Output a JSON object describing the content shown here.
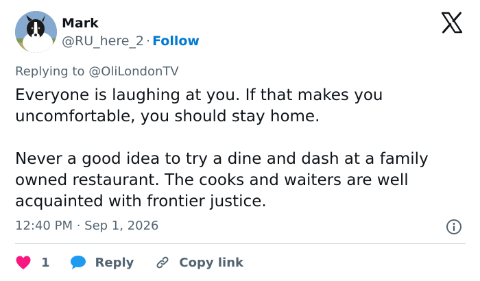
{
  "author": {
    "name": "Mark",
    "handle": "@RU_here_2",
    "separator": "·",
    "follow_label": "Follow"
  },
  "reply_context": {
    "prefix": "Replying to",
    "mention": "@OliLondonTV"
  },
  "tweet": {
    "paragraphs": [
      "Everyone is laughing at you. If that makes you uncomfortable, you should stay home.",
      "Never a good idea to try a dine and dash at a family owned restaurant. The cooks and waiters are well acquainted with frontier justice."
    ],
    "timestamp": "12:40 PM · Sep 1, 2026"
  },
  "actions": {
    "like_count": "1",
    "reply_label": "Reply",
    "copy_label": "Copy link"
  },
  "icons": {
    "brand": "x-logo-icon",
    "info": "info-icon",
    "like": "heart-icon",
    "reply": "speech-bubble-icon",
    "copy": "link-icon"
  },
  "colors": {
    "text": "#0f1419",
    "secondary": "#536471",
    "follow": "#0079d3",
    "heart": "#f91880",
    "reply_bubble": "#1d9bf0",
    "divider": "#cfd9de"
  }
}
